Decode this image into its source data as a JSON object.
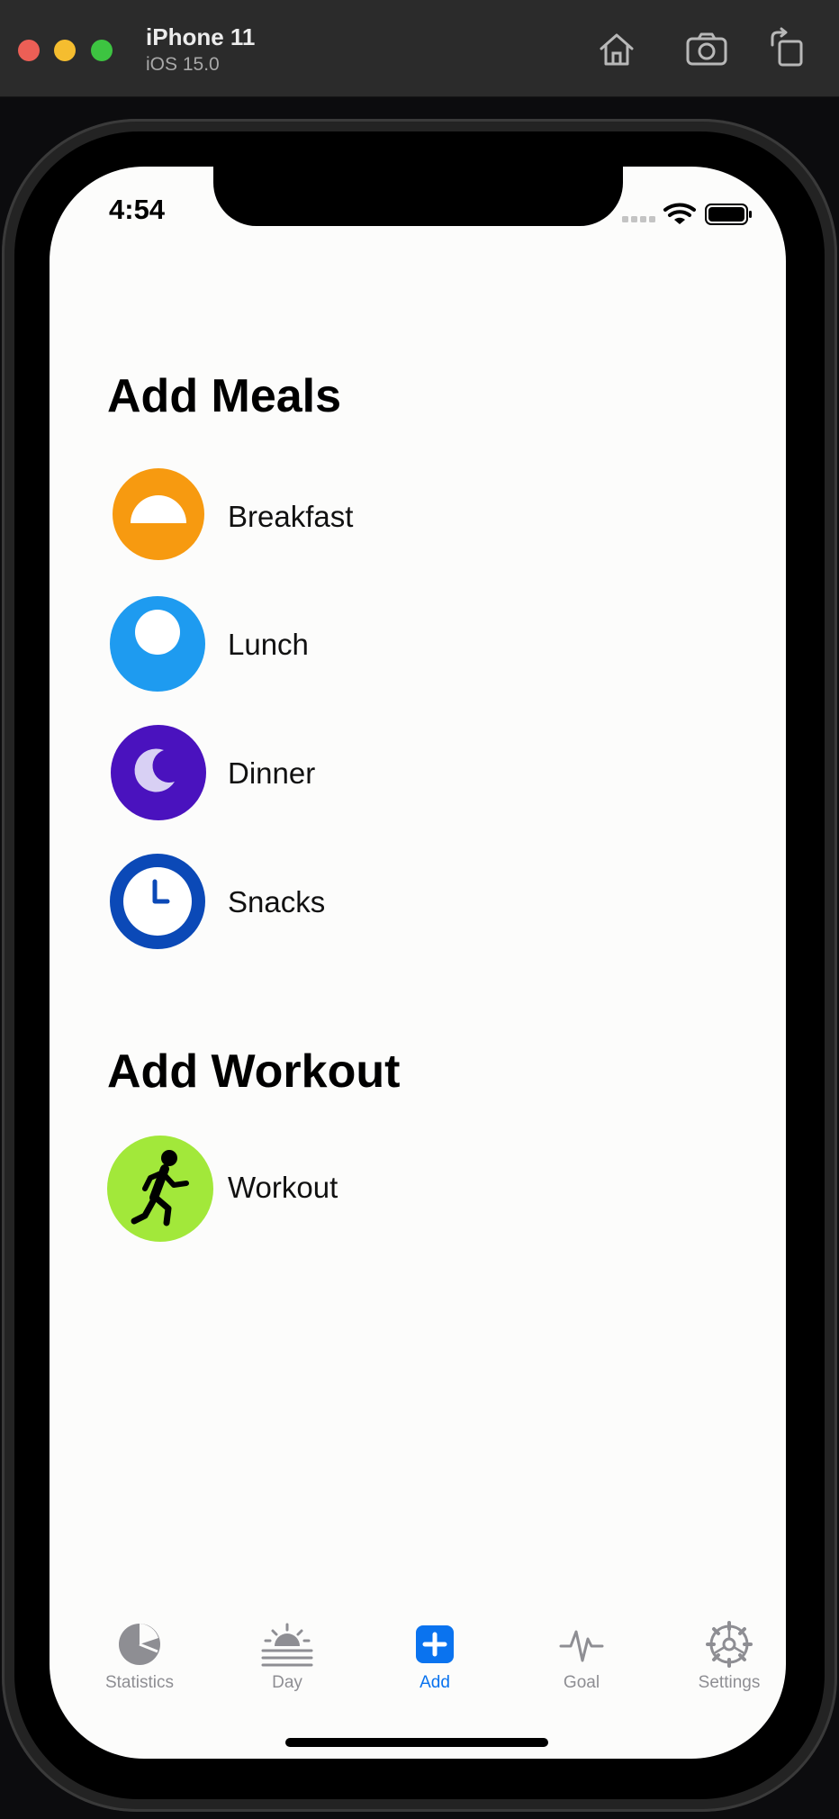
{
  "simulator": {
    "device_name": "iPhone 11",
    "os_version": "iOS 15.0",
    "buttons": [
      {
        "icon": "home-icon"
      },
      {
        "icon": "screenshot-icon"
      },
      {
        "icon": "rotate-icon"
      }
    ]
  },
  "status_bar": {
    "time": "4:54",
    "icons": [
      "cellular-icon",
      "wifi-icon",
      "battery-icon"
    ]
  },
  "meals": {
    "title": "Add Meals",
    "items": [
      {
        "label": "Breakfast",
        "icon": "sunrise-icon",
        "color": "#F79A10"
      },
      {
        "label": "Lunch",
        "icon": "sun-icon",
        "color": "#1E9BF0"
      },
      {
        "label": "Dinner",
        "icon": "moon-icon",
        "color": "#4A12BE"
      },
      {
        "label": "Snacks",
        "icon": "clock-icon",
        "color": "#0B49B7"
      }
    ]
  },
  "workout": {
    "title": "Add Workout",
    "items": [
      {
        "label": "Workout",
        "icon": "running-figure-icon",
        "color": "#A2E83A"
      }
    ]
  },
  "tab_bar": {
    "active": "Add",
    "accent_color": "#0A73EF",
    "inactive_color": "#8E8E93",
    "tabs": [
      {
        "label": "Statistics",
        "icon": "pie-chart-icon"
      },
      {
        "label": "Day",
        "icon": "sunrise-lines-icon"
      },
      {
        "label": "Add",
        "icon": "plus-square-icon"
      },
      {
        "label": "Goal",
        "icon": "waveform-icon"
      },
      {
        "label": "Settings",
        "icon": "gear-icon"
      }
    ]
  }
}
